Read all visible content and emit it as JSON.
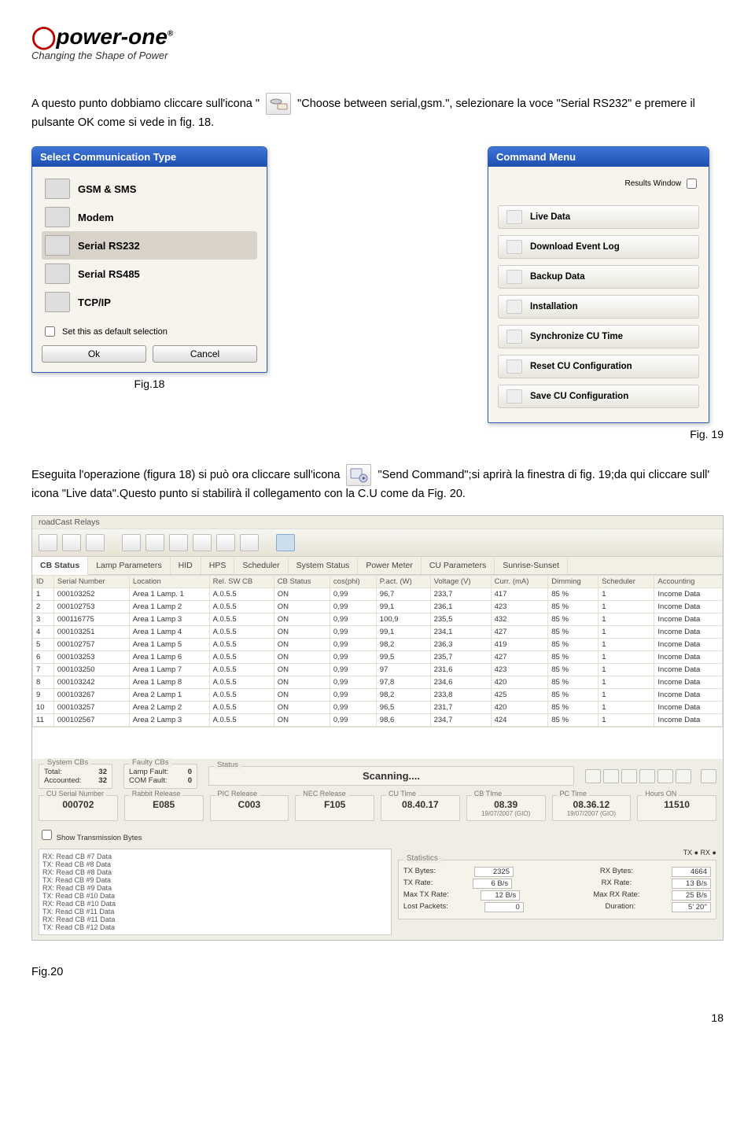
{
  "logo": {
    "text": "power-one",
    "tagline": "Changing the Shape of Power"
  },
  "para1_a": "A  questo punto dobbiamo cliccare sull'icona \"",
  "icon1_name": "modem-icon",
  "para1_b": " \"Choose between serial,gsm.\", selezionare la voce \"Serial RS232\" e premere il pulsante OK come si vede in fig. 18.",
  "dlg1": {
    "title": "Select Communication Type",
    "items": [
      "GSM & SMS",
      "Modem",
      "Serial RS232",
      "Serial RS485",
      "TCP/IP"
    ],
    "selected_idx": 2,
    "checkbox": "Set this as default selection",
    "ok": "Ok",
    "cancel": "Cancel"
  },
  "fig18": "Fig.18",
  "dlg2": {
    "title": "Command Menu",
    "results": "Results Window",
    "buttons": [
      "Live Data",
      "Download Event Log",
      "Backup Data",
      "Installation",
      "Synchronize CU Time",
      "Reset CU Configuration",
      "Save CU Configuration"
    ]
  },
  "fig19": "Fig. 19",
  "para2_a": "Eseguita l'operazione (figura 18) si può ora  cliccare sull'icona ",
  "icon2_name": "send-command-icon",
  "para2_b": " \"Send Command\";si aprirà la finestra di fig. 19;da qui cliccare sull' icona  \"Live data\".Questo punto si stabilirà il collegamento con la C.U come da  Fig. 20.",
  "app": {
    "menu": "roadCast  Relays",
    "tabs": [
      "CB Status",
      "Lamp Parameters",
      "HID",
      "HPS",
      "Scheduler",
      "System Status",
      "Power Meter",
      "CU Parameters",
      "Sunrise-Sunset"
    ],
    "active_tab": 0,
    "cols": [
      "ID",
      "Serial Number",
      "Location",
      "Rel. SW CB",
      "CB Status",
      "cos(phi)",
      "P.act. (W)",
      "Voltage (V)",
      "Curr. (mA)",
      "Dimming",
      "Scheduler",
      "Accounting"
    ],
    "rows": [
      [
        "1",
        "000103252",
        "Area 1  Lamp. 1",
        "A.0.5.5",
        "ON",
        "0,99",
        "96,7",
        "233,7",
        "417",
        "85 %",
        "1",
        "Income Data"
      ],
      [
        "2",
        "000102753",
        "Area 1  Lamp  2",
        "A.0.5.5",
        "ON",
        "0,99",
        "99,1",
        "236,1",
        "423",
        "85 %",
        "1",
        "Income Data"
      ],
      [
        "3",
        "000116775",
        "Area 1  Lamp  3",
        "A.0.5.5",
        "ON",
        "0,99",
        "100,9",
        "235,5",
        "432",
        "85 %",
        "1",
        "Income Data"
      ],
      [
        "4",
        "000103251",
        "Area 1  Lamp  4",
        "A.0.5.5",
        "ON",
        "0,99",
        "99,1",
        "234,1",
        "427",
        "85 %",
        "1",
        "Income Data"
      ],
      [
        "5",
        "000102757",
        "Area 1  Lamp  5",
        "A.0.5.5",
        "ON",
        "0,99",
        "98,2",
        "236,3",
        "419",
        "85 %",
        "1",
        "Income Data"
      ],
      [
        "6",
        "000103253",
        "Area 1  Lamp  6",
        "A.0.5.5",
        "ON",
        "0,99",
        "99,5",
        "235,7",
        "427",
        "85 %",
        "1",
        "Income Data"
      ],
      [
        "7",
        "000103250",
        "Area 1  Lamp  7",
        "A.0.5.5",
        "ON",
        "0,99",
        "97",
        "231,6",
        "423",
        "85 %",
        "1",
        "Income Data"
      ],
      [
        "8",
        "000103242",
        "Area 1  Lamp  8",
        "A.0.5.5",
        "ON",
        "0,99",
        "97,8",
        "234,6",
        "420",
        "85 %",
        "1",
        "Income Data"
      ],
      [
        "9",
        "000103267",
        "Area 2  Lamp  1",
        "A.0.5.5",
        "ON",
        "0,99",
        "98,2",
        "233,8",
        "425",
        "85 %",
        "1",
        "Income Data"
      ],
      [
        "10",
        "000103257",
        "Area 2  Lamp  2",
        "A.0.5.5",
        "ON",
        "0,99",
        "96,5",
        "231,7",
        "420",
        "85 %",
        "1",
        "Income Data"
      ],
      [
        "11",
        "000102567",
        "Area 2  Lamp  3",
        "A.0.5.5",
        "ON",
        "0,99",
        "98,6",
        "234,7",
        "424",
        "85 %",
        "1",
        "Income Data"
      ]
    ],
    "status": {
      "system": {
        "title": "System CBs",
        "Total": "32",
        "Accounted": "32"
      },
      "faulty": {
        "title": "Faulty CBs",
        "Lamp Fault": "0",
        "COM Fault": "0"
      },
      "status_title": "Status",
      "scanning": "Scanning....",
      "releases": [
        {
          "t": "CU Serial Number",
          "v": "000702"
        },
        {
          "t": "Rabbit Release",
          "v": "E085"
        },
        {
          "t": "PIC Release",
          "v": "C003"
        },
        {
          "t": "NEC Release",
          "v": "F105"
        },
        {
          "t": "CU Time",
          "v": "08.40.17"
        },
        {
          "t": "CB TIme",
          "v": "08.39",
          "s": "19/07/2007 (GIO)"
        },
        {
          "t": "PC Time",
          "v": "08.36.12",
          "s": "19/07/2007 (GIO)"
        },
        {
          "t": "Hours ON",
          "v": "11510"
        }
      ],
      "show_tx": "Show Transmission Bytes",
      "txlog": [
        "RX: Read CB #7 Data",
        "TX: Read CB #8 Data",
        "RX: Read CB #8 Data",
        "TX: Read CB #9 Data",
        "RX: Read CB #9 Data",
        "TX: Read CB #10 Data",
        "RX: Read CB #10 Data",
        "TX: Read CB #11 Data",
        "RX: Read CB #11 Data",
        "TX: Read CB #12 Data"
      ],
      "txrx": "TX ●    RX ●",
      "stats_title": "Statistics",
      "stats": [
        {
          "k": "TX Bytes:",
          "v": "2325",
          "k2": "RX Bytes:",
          "v2": "4664"
        },
        {
          "k": "TX Rate:",
          "v": "6 B/s",
          "k2": "RX Rate:",
          "v2": "13 B/s"
        },
        {
          "k": "Max TX Rate:",
          "v": "12 B/s",
          "k2": "Max RX Rate:",
          "v2": "25 B/s"
        },
        {
          "k": "Lost Packets:",
          "v": "0",
          "k2": "Duration:",
          "v2": "5' 20''"
        }
      ]
    }
  },
  "fig20": "Fig.20",
  "page": "18"
}
